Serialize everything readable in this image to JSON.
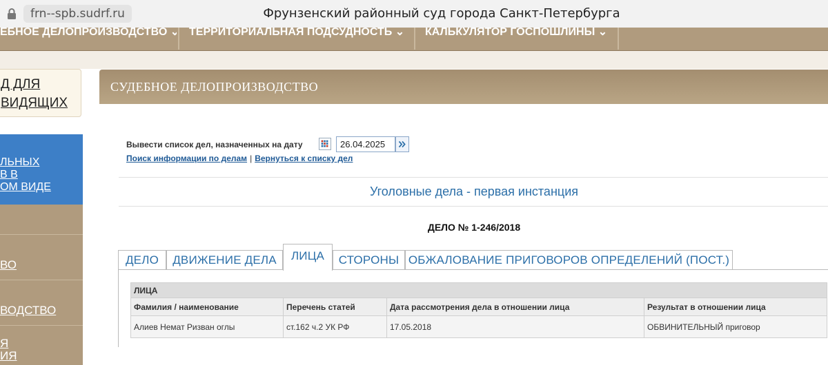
{
  "browser": {
    "url": "frn--spb.sudrf.ru",
    "title": "Фрунзенский районный суд города Санкт-Петербурга"
  },
  "top_nav": {
    "items": [
      "ЕБНОЕ ДЕЛОПРОИЗВОДСТВО ⌄",
      "ТЕРРИТОРИАЛЬНАЯ ПОДСУДНОСТЬ ⌄",
      "КАЛЬКУЛЯТОР ГОСПОШЛИНЫ ⌄"
    ]
  },
  "sidebar": {
    "card_lines": [
      "Д ДЛЯ",
      "ВИДЯЩИХ"
    ],
    "blue_lines": [
      "ЛЬНЫХ",
      "В В",
      "ОМ ВИДЕ"
    ],
    "links": [
      "ВО",
      "ВОДСТВО",
      "Я",
      "ИЯ"
    ]
  },
  "main": {
    "header": "СУДЕБНОЕ ДЕЛОПРОИЗВОДСТВО",
    "date_label": "Вывести список дел, назначенных на дату",
    "date_value": "26.04.2025",
    "link_search": "Поиск информации по делам",
    "link_separator": "|",
    "link_back": "Вернуться к списку дел",
    "section_title": "Уголовные дела - первая инстанция",
    "case_number": "ДЕЛО № 1-246/2018"
  },
  "tabs": [
    {
      "label": "ДЕЛО",
      "active": false
    },
    {
      "label": "ДВИЖЕНИЕ ДЕЛА",
      "active": false
    },
    {
      "label": "ЛИЦА",
      "active": true
    },
    {
      "label": "СТОРОНЫ",
      "active": false
    },
    {
      "label": "ОБЖАЛОВАНИЕ ПРИГОВОРОВ ОПРЕДЕЛЕНИЙ (ПОСТ.)",
      "active": false
    }
  ],
  "table": {
    "caption": "ЛИЦА",
    "headers": [
      "Фамилия / наименование",
      "Перечень статей",
      "Дата рассмотрения дела в отношении лица",
      "Результат в отношении лица"
    ],
    "rows": [
      [
        "Алиев Немат Ризван оглы",
        "ст.162 ч.2 УК РФ",
        "17.05.2018",
        "ОБВИНИТЕЛЬНЫЙ приговор"
      ]
    ]
  },
  "colors": {
    "nav_brown": "#b09b7e",
    "sidebar_blue": "#3d7fc7",
    "link_blue": "#1f5a96",
    "title_blue": "#2c6fa8"
  }
}
